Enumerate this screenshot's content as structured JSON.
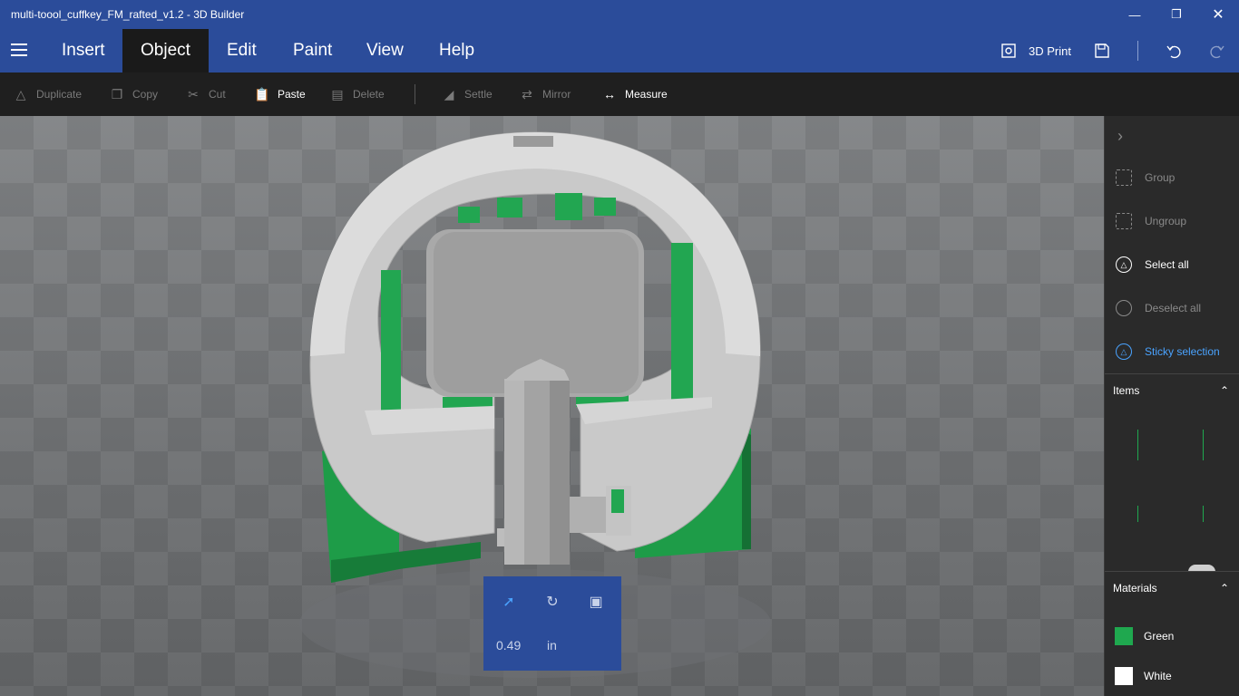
{
  "window": {
    "title": "multi-toool_cuffkey_FM_rafted_v1.2 - 3D Builder",
    "minimize_icon": "minimize-icon",
    "restore_icon": "restore-icon",
    "close_icon": "close-icon"
  },
  "menu": {
    "tabs": [
      {
        "label": "Insert",
        "active": false
      },
      {
        "label": "Object",
        "active": true
      },
      {
        "label": "Edit",
        "active": false
      },
      {
        "label": "Paint",
        "active": false
      },
      {
        "label": "View",
        "active": false
      },
      {
        "label": "Help",
        "active": false
      }
    ],
    "print_label": "3D Print",
    "icons": [
      "hamburger-icon",
      "printer-icon",
      "save-icon",
      "undo-icon",
      "redo-icon"
    ]
  },
  "toolbar": {
    "items": [
      {
        "label": "Duplicate",
        "enabled": false,
        "icon": "duplicate-icon"
      },
      {
        "label": "Copy",
        "enabled": false,
        "icon": "copy-icon"
      },
      {
        "label": "Cut",
        "enabled": false,
        "icon": "cut-icon"
      },
      {
        "label": "Paste",
        "enabled": true,
        "icon": "paste-icon"
      },
      {
        "label": "Delete",
        "enabled": false,
        "icon": "delete-icon"
      },
      {
        "label": "Settle",
        "enabled": false,
        "icon": "settle-icon"
      },
      {
        "label": "Mirror",
        "enabled": false,
        "icon": "mirror-icon"
      },
      {
        "label": "Measure",
        "enabled": true,
        "icon": "measure-icon"
      }
    ]
  },
  "side_panel": {
    "actions": [
      {
        "label": "Group",
        "enabled": false
      },
      {
        "label": "Ungroup",
        "enabled": false
      },
      {
        "label": "Select all",
        "enabled": true
      },
      {
        "label": "Deselect all",
        "enabled": false
      },
      {
        "label": "Sticky selection",
        "enabled": true
      }
    ],
    "items_title": "Items",
    "materials_title": "Materials",
    "materials": [
      {
        "name": "Green",
        "color": "#1fa84f"
      },
      {
        "name": "White",
        "color": "#ffffff"
      }
    ]
  },
  "gizmo": {
    "value": "0.49",
    "unit": "in",
    "icons": [
      "move-icon",
      "rotate-icon",
      "scale-icon"
    ]
  },
  "colors": {
    "accent": "#2b4c9a",
    "highlight": "#4aa3ff",
    "model_white": "#c8c8c8",
    "model_green": "#1fa84f"
  }
}
